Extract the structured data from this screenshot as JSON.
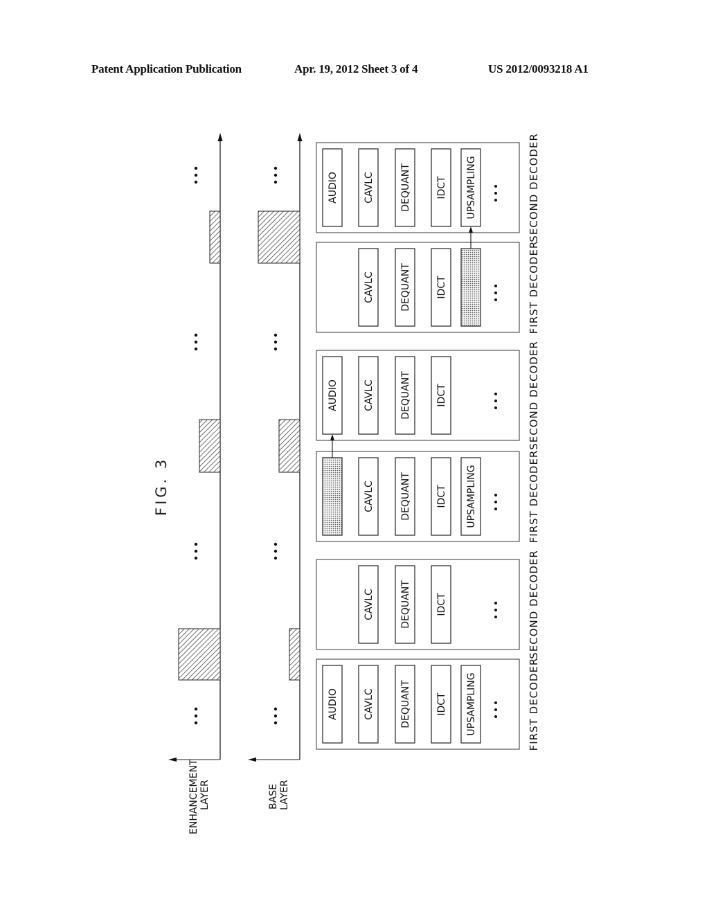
{
  "header": {
    "left": "Patent Application Publication",
    "middle": "Apr. 19, 2012  Sheet 3 of 4",
    "right": "US 2012/0093218 A1"
  },
  "figure": {
    "title": "FIG. 3",
    "axes": [
      {
        "id": "enhancement",
        "label_line1": "ENHANCEMENT",
        "label_line2": "LAYER"
      },
      {
        "id": "base",
        "label_line1": "BASE",
        "label_line2": "LAYER"
      }
    ],
    "ellipsis": "• • •",
    "pulses": [
      {
        "layer": "enhancement",
        "slot": 1,
        "size": "large"
      },
      {
        "layer": "base",
        "slot": 1,
        "size": "small"
      },
      {
        "layer": "enhancement",
        "slot": 2,
        "size": "medium"
      },
      {
        "layer": "base",
        "slot": 2,
        "size": "medium"
      },
      {
        "layer": "enhancement",
        "slot": 3,
        "size": "small"
      },
      {
        "layer": "base",
        "slot": 3,
        "size": "large"
      }
    ],
    "decoders": [
      {
        "label": "FIRST DECODER",
        "blocks": [
          "AUDIO",
          "CAVLC",
          "DEQUANT",
          "IDCT",
          "UPSAMPLING"
        ],
        "shaded": []
      },
      {
        "label": "SECOND DECODER",
        "blocks": [
          "",
          "CAVLC",
          "DEQUANT",
          "IDCT",
          ""
        ],
        "shaded": []
      },
      {
        "label": "FIRST DECODER",
        "blocks": [
          "",
          "CAVLC",
          "DEQUANT",
          "IDCT",
          "UPSAMPLING"
        ],
        "shaded": [
          0
        ]
      },
      {
        "label": "SECOND DECODER",
        "blocks": [
          "AUDIO",
          "CAVLC",
          "DEQUANT",
          "IDCT",
          ""
        ],
        "shaded": []
      },
      {
        "label": "FIRST DECODER",
        "blocks": [
          "",
          "CAVLC",
          "DEQUANT",
          "IDCT",
          ""
        ],
        "shaded": [
          4
        ]
      },
      {
        "label": "SECOND DECODER",
        "blocks": [
          "AUDIO",
          "CAVLC",
          "DEQUANT",
          "IDCT",
          "UPSAMPLING"
        ],
        "shaded": []
      }
    ],
    "transfers": [
      {
        "from_decoder": 2,
        "from_block": 0,
        "to_decoder": 3,
        "to_block": 0
      },
      {
        "from_decoder": 4,
        "from_block": 4,
        "to_decoder": 5,
        "to_block": 4
      }
    ]
  }
}
